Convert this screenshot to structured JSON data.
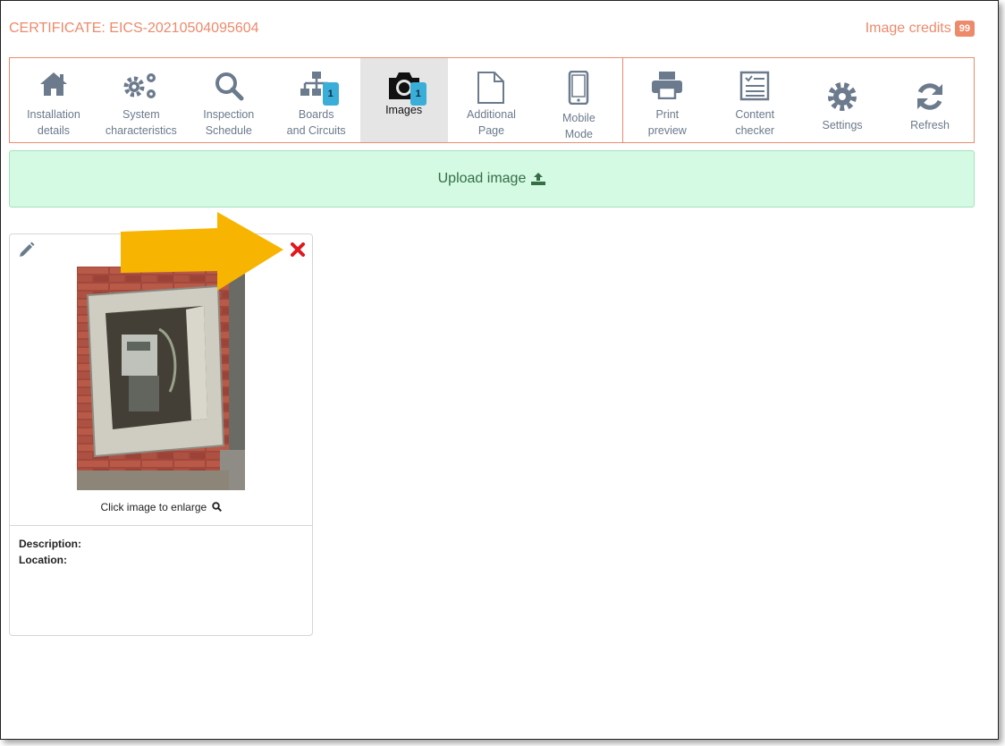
{
  "header": {
    "certificate": "CERTIFICATE: EICS-20210504095604",
    "credits_label": "Image credits",
    "credits_count": "99"
  },
  "toolbar": {
    "items": [
      {
        "label": "Installation\ndetails",
        "icon": "home-icon"
      },
      {
        "label": "System\ncharacteristics",
        "icon": "cogs-icon"
      },
      {
        "label": "Inspection\nSchedule",
        "icon": "search-icon"
      },
      {
        "label": "Boards\nand Circuits",
        "icon": "sitemap-icon",
        "badge": "1"
      },
      {
        "label": "Images",
        "icon": "camera-icon",
        "badge": "1",
        "active": true
      },
      {
        "label": "Additional\nPage",
        "icon": "file-icon"
      },
      {
        "label": "Mobile\nMode",
        "icon": "mobile-icon"
      },
      {
        "label": "Print\npreview",
        "icon": "print-icon"
      },
      {
        "label": "Content\nchecker",
        "icon": "checklist-icon"
      },
      {
        "label": "Settings",
        "icon": "gear-icon"
      },
      {
        "label": "Refresh",
        "icon": "refresh-icon"
      }
    ]
  },
  "upload": {
    "label": "Upload image"
  },
  "image_card": {
    "enlarge_hint": "Click image to enlarge",
    "description_label": "Description:",
    "location_label": "Location:"
  },
  "colors": {
    "accent": "#ed8a6c",
    "badge": "#3aaed8",
    "upload_bg": "#d4fae4",
    "delete": "#e0181e",
    "annotation_arrow": "#f7b400"
  }
}
